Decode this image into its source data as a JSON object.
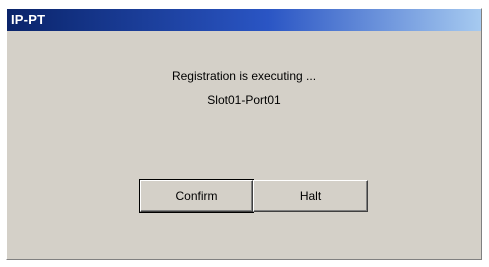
{
  "window": {
    "title": "IP-PT"
  },
  "dialog": {
    "message": "Registration is executing ...",
    "detail": "Slot01-Port01"
  },
  "buttons": {
    "confirm_label": "Confirm",
    "halt_label": "Halt"
  },
  "colors": {
    "title_bar_start": "#0a246a",
    "title_bar_end": "#a6caf0",
    "dialog_background": "#d4d0c8",
    "title_text": "#ffffff"
  }
}
